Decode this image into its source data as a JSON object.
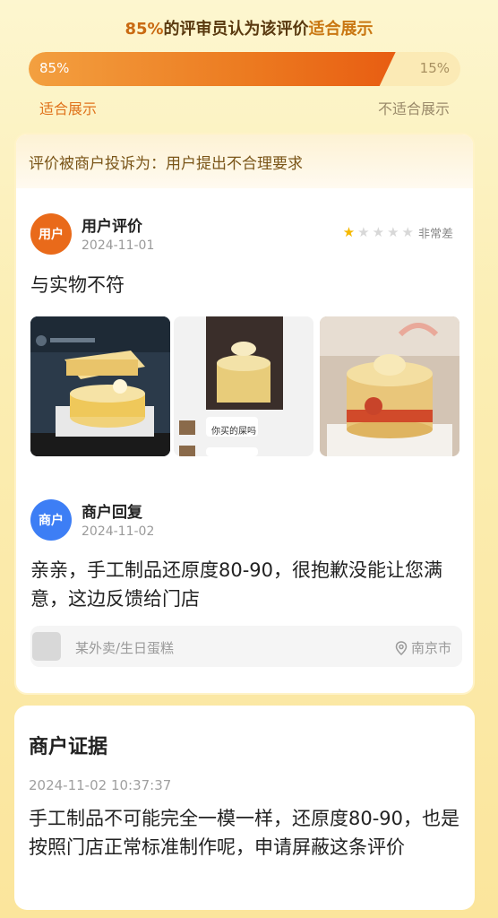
{
  "header": {
    "percent": "85%",
    "middle": "的评审员认为该评价",
    "highlight": "适合展示"
  },
  "vote": {
    "suitable_value": "85%",
    "unsuitable_value": "15%",
    "suitable_fraction": 0.85,
    "suitable_label": "适合展示",
    "unsuitable_label": "不适合展示"
  },
  "complaint": {
    "text": "评价被商户投诉为：用户提出不合理要求"
  },
  "user_review": {
    "avatar_text": "用户",
    "name": "用户评价",
    "date": "2024-11-01",
    "rating": 1,
    "rating_max": 5,
    "rating_text": "非常差",
    "text": "与实物不符",
    "photo2_caption": "你买的屎吗"
  },
  "merchant_reply": {
    "avatar_text": "商户",
    "name": "商户回复",
    "date": "2024-11-02",
    "text": "亲亲，手工制品还原度80-90，很抱歉没能让您满意，这边反馈给门店"
  },
  "tag": {
    "shop": "某外卖/生日蛋糕",
    "location": "南京市"
  },
  "evidence": {
    "title": "商户证据",
    "timestamp": "2024-11-02 10:37:37",
    "text": "手工制品不可能完全一模一样，还原度80-90，也是按照门店正常标准制作呢，申请屏蔽这条评价"
  },
  "colors": {
    "accent_orange": "#e96a1a",
    "merchant_blue": "#3d7ef5",
    "star": "#f5b800"
  }
}
